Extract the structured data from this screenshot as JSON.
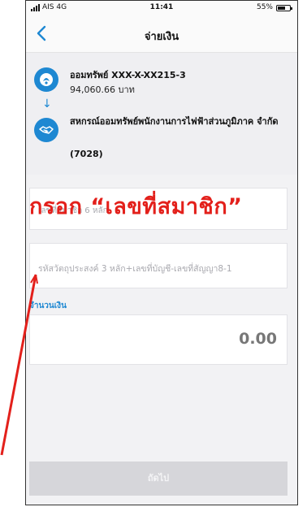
{
  "status_bar": {
    "carrier": "AIS 4G",
    "time": "11:41",
    "battery": "55%"
  },
  "header": {
    "title": "จ่ายเงิน",
    "back_icon": "chevron-left-icon"
  },
  "from_account": {
    "name": "ออมทรัพย์ XXX-X-XX215-3",
    "balance": "94,060.66 บาท",
    "icon": "bank-logo-icon"
  },
  "to_account": {
    "name": "สหกรณ์ออมทรัพย์พนักงานการไฟฟ้าส่วนภูมิภาค จำกัด",
    "code": "(7028)",
    "icon": "handshake-icon"
  },
  "form": {
    "member_placeholder": "เลขที่สมาชิก 6 หลัก",
    "reference_placeholder": "รหัสวัตถุประสงค์ 3 หลัก+เลขที่บัญชี-เลขที่สัญญา8-1",
    "amount_label": "จำนวนเงิน",
    "amount_value": "0.00"
  },
  "annotation": {
    "text": "กรอก “เลขที่สมาชิก”",
    "color": "#e3201b"
  },
  "submit_label": "ถัดไป",
  "colors": {
    "accent": "#1e88d2",
    "annotation": "#e3201b",
    "disabled_button": "#d6d6da"
  }
}
